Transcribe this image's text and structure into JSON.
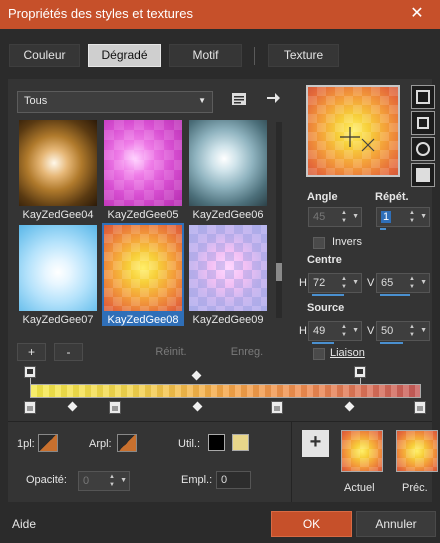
{
  "window": {
    "title": "Propriétés des styles et textures",
    "close_glyph": "✕"
  },
  "tabs": [
    {
      "label": "Couleur",
      "active": false
    },
    {
      "label": "Dégradé",
      "active": true
    },
    {
      "label": "Motif",
      "active": false
    },
    {
      "label": "Texture",
      "active": false
    }
  ],
  "category": {
    "value": "Tous"
  },
  "gradients": [
    {
      "name": "KayZedGee04",
      "selected": false
    },
    {
      "name": "KayZedGee05",
      "selected": false
    },
    {
      "name": "KayZedGee06",
      "selected": false
    },
    {
      "name": "KayZedGee07",
      "selected": false
    },
    {
      "name": "KayZedGee08",
      "selected": true
    },
    {
      "name": "KayZedGee09",
      "selected": false
    }
  ],
  "list_buttons": {
    "add": "+",
    "remove": "-",
    "reset": "Réinit.",
    "save": "Enreg."
  },
  "angle": {
    "label": "Angle",
    "value": "45"
  },
  "repeat": {
    "label": "Répét.",
    "value": "1"
  },
  "invert": {
    "label": "Invers",
    "checked": false
  },
  "center": {
    "label": "Centre",
    "h_label": "H",
    "h_value": "72",
    "v_label": "V",
    "v_value": "65"
  },
  "source": {
    "label": "Source",
    "h_label": "H",
    "h_value": "49",
    "v_label": "V",
    "v_value": "50"
  },
  "link": {
    "label": "Liaison",
    "checked": false
  },
  "markers": {
    "opacity_stops": [
      0,
      85
    ],
    "midpoints": [
      43,
      83
    ],
    "color_stops": [
      0,
      22,
      63,
      100
    ],
    "color_midpoints": [
      11,
      43,
      81
    ]
  },
  "stop_settings": {
    "label_1pl": "1pl:",
    "label_arpl": "Arpl:",
    "label_util": "Util.:",
    "util_colors": [
      "#000000",
      "#e8d68a"
    ],
    "opacity_label": "Opacité:",
    "opacity_value": "0",
    "location_label": "Empl.:",
    "location_value": "0"
  },
  "preview_panel": {
    "add": "+",
    "current_label": "Actuel",
    "previous_label": "Préc."
  },
  "footer": {
    "help": "Aide",
    "ok": "OK",
    "cancel": "Annuler"
  },
  "colors": {
    "accent": "#c6502a",
    "selection": "#2f6fb8",
    "ok_button": "#c6502a"
  }
}
